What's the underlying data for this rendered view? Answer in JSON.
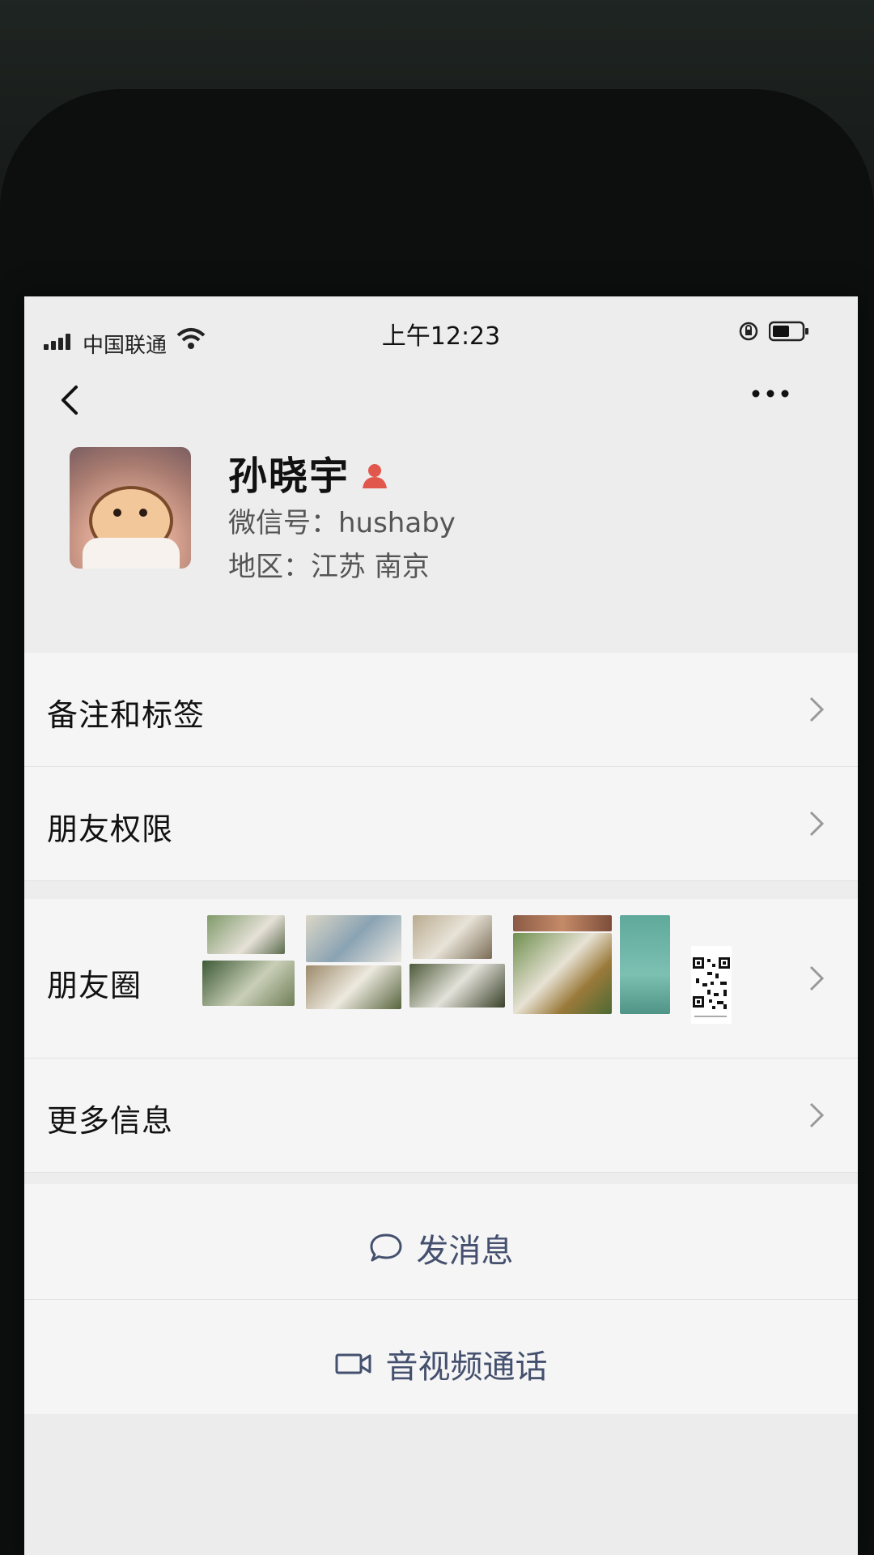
{
  "status_bar": {
    "carrier": "中国联通",
    "time": "上午12:23"
  },
  "profile": {
    "name": "孙晓宇",
    "wechat_id": "微信号：hushaby",
    "region": "地区：江苏 南京"
  },
  "menu": {
    "remarks": "备注和标签",
    "permissions": "朋友权限",
    "moments": "朋友圈",
    "more_info": "更多信息"
  },
  "actions": {
    "message": "发消息",
    "video_call": "音视频通话"
  },
  "icons": {
    "back": "back-icon",
    "more": "more-icon",
    "gender": "gender-icon",
    "chevron": "chevron-right-icon",
    "chat": "chat-bubble-icon",
    "video": "video-camera-icon"
  },
  "colors": {
    "action_text": "#44506e",
    "gender_badge": "#e2574c"
  }
}
